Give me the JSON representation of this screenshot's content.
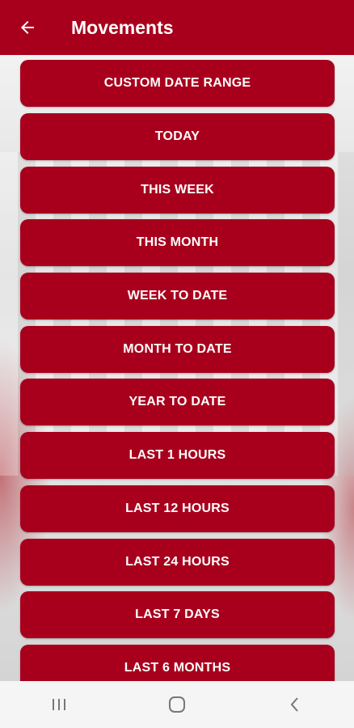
{
  "header": {
    "title": "Movements",
    "back_icon": "arrow-left-icon",
    "background": "#a8001c"
  },
  "options": [
    {
      "label": "CUSTOM DATE RANGE"
    },
    {
      "label": "TODAY"
    },
    {
      "label": "THIS WEEK"
    },
    {
      "label": "THIS MONTH"
    },
    {
      "label": "WEEK TO DATE"
    },
    {
      "label": "MONTH TO DATE"
    },
    {
      "label": "YEAR TO DATE"
    },
    {
      "label": "LAST 1 HOURS"
    },
    {
      "label": "LAST 12 HOURS"
    },
    {
      "label": "LAST 24 HOURS"
    },
    {
      "label": "LAST 7 DAYS"
    },
    {
      "label": "LAST 6 MONTHS"
    }
  ],
  "navbar": {
    "recent_icon": "recent-apps-icon",
    "home_icon": "home-icon",
    "back_icon": "system-back-icon"
  }
}
